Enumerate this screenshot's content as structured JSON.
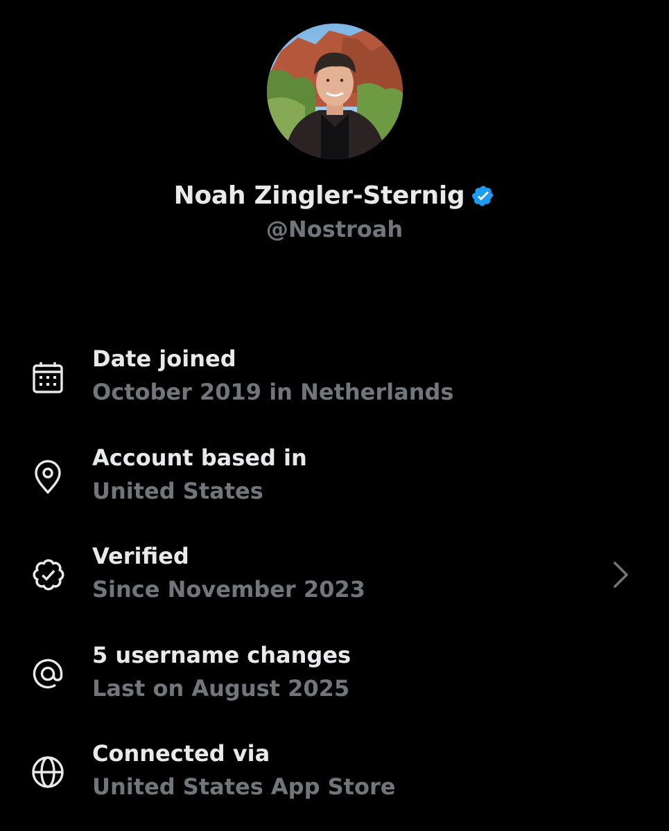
{
  "profile": {
    "display_name": "Noah Zingler-Sternig",
    "handle": "@Nostroah",
    "verified": true,
    "avatar_icon": "profile-photo"
  },
  "about": {
    "items": [
      {
        "icon": "calendar-icon",
        "title": "Date joined",
        "subtitle": "October 2019 in Netherlands",
        "has_chevron": false
      },
      {
        "icon": "location-pin-icon",
        "title": "Account based in",
        "subtitle": "United States",
        "has_chevron": false
      },
      {
        "icon": "verified-check-icon",
        "title": "Verified",
        "subtitle": "Since November 2023",
        "has_chevron": true
      },
      {
        "icon": "at-sign-icon",
        "title": "5 username changes",
        "subtitle": "Last on August 2025",
        "has_chevron": false
      },
      {
        "icon": "globe-icon",
        "title": "Connected via",
        "subtitle": "United States App Store",
        "has_chevron": false
      }
    ]
  },
  "colors": {
    "background": "#000000",
    "primary_text": "#e7e9ea",
    "secondary_text": "#71767b",
    "verified_blue": "#1d9bf0"
  }
}
